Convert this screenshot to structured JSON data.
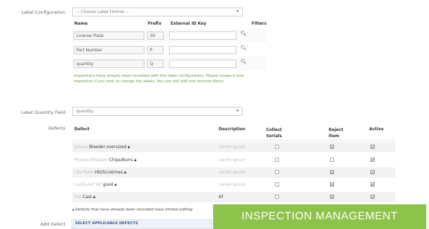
{
  "label_config": {
    "label": "Label Configuration",
    "select_value": "-- Choose Label Format --",
    "headers": {
      "name": "Name",
      "prefix": "Prefix",
      "external_id": "External ID Key",
      "filters": "Filters"
    },
    "rows": [
      {
        "name": "License Plate",
        "prefix": "30",
        "external_id": ""
      },
      {
        "name": "Part Number",
        "prefix": "P",
        "external_id": ""
      },
      {
        "name": "quantity",
        "prefix": "Q",
        "external_id": ""
      }
    ],
    "note": "Inspections have already been recorded with this label configuration. Please create a new inspection if you wish to change the labels. You can still add and remove filters."
  },
  "quantity_field": {
    "label": "Label Quantity Field",
    "value": "quantity"
  },
  "defects": {
    "label": "Defects",
    "headers": {
      "defect": "Defect",
      "description": "Description",
      "collect_serials": "Collect Serials",
      "reject_item": "Reject Item",
      "active": "Active"
    },
    "rows": [
      {
        "prefix": "Jabsen",
        "name": "Bleeder oversized",
        "description": "Lorem Ipsum",
        "collect": false,
        "reject": true,
        "active": true
      },
      {
        "prefix": "Rhovan/Mustato",
        "name": "Chips/Burrs",
        "description": "Lorem Ipsum",
        "collect": false,
        "reject": false,
        "active": true
      },
      {
        "prefix": "Lite Plate",
        "name": "HD/Scratches",
        "description": "Lorem Ipsum",
        "collect": false,
        "reject": true,
        "active": true
      },
      {
        "prefix": "Lumb Ant Yet",
        "name": "good",
        "description": "Lorem Ipsum",
        "collect": false,
        "reject": true,
        "active": true
      },
      {
        "prefix": "Fox",
        "name": "Cast",
        "description": "AT",
        "collect": false,
        "reject": true,
        "active": true
      }
    ],
    "note": "Defects that have already been recorded have limited editing"
  },
  "add_defect": {
    "label": "Add Defect",
    "button": "SELECT APPLICABLE DEFECTS"
  },
  "banner": {
    "text": "INSPECTION MANAGEMENT",
    "color": "#8cc34a"
  }
}
